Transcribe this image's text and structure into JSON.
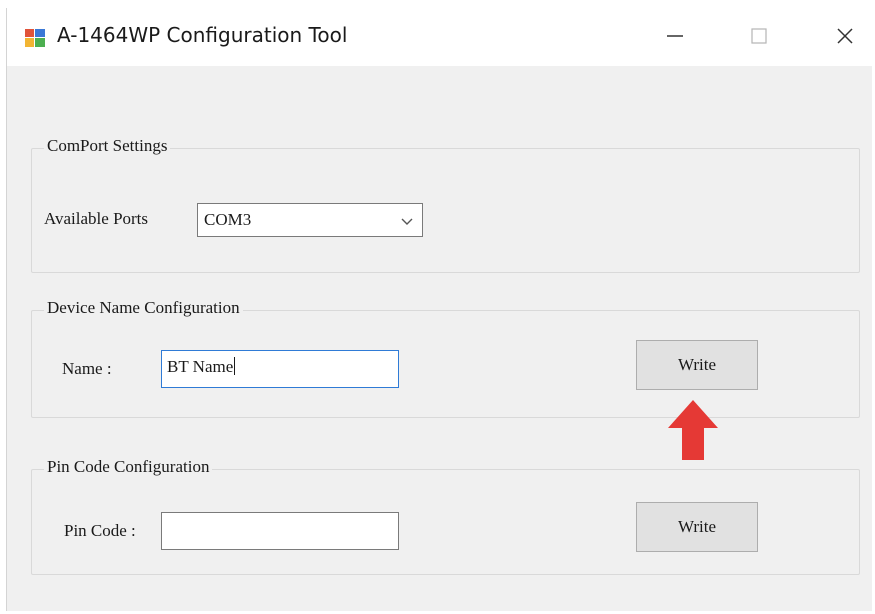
{
  "window": {
    "title": "A-1464WP Configuration Tool",
    "minimize_icon": "minimize-icon",
    "maximize_icon": "maximize-icon",
    "close_icon": "close-icon"
  },
  "comport": {
    "group_label": "ComPort Settings",
    "ports_label": "Available Ports",
    "ports_value": "COM3"
  },
  "device_name": {
    "group_label": "Device Name Configuration",
    "name_label": "Name :",
    "name_value": "BT Name",
    "write_label": "Write"
  },
  "pin_code": {
    "group_label": "Pin Code Configuration",
    "pin_label": "Pin Code :",
    "pin_value": "",
    "write_label": "Write"
  },
  "colors": {
    "focus_border": "#2f7bd6",
    "arrow": "#e53935"
  },
  "annotation": {
    "arrow_icon": "red-up-arrow-icon"
  }
}
